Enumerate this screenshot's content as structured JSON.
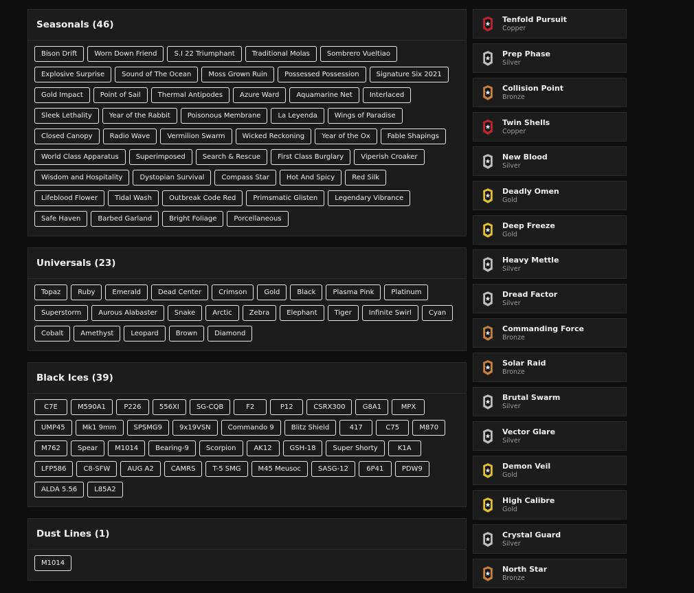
{
  "sections": [
    {
      "title": "Seasonals (46)",
      "tags": [
        "Bison Drift",
        "Worn Down Friend",
        "S.I 22 Triumphant",
        "Traditional Molas",
        "Sombrero Vueltiao",
        "Explosive Surprise",
        "Sound of The Ocean",
        "Moss Grown Ruin",
        "Possessed Possession",
        "Signature Six 2021",
        "Gold Impact",
        "Point of Sail",
        "Thermal Antipodes",
        "Azure Ward",
        "Aquamarine Net",
        "Interlaced",
        "Sleek Lethality",
        "Year of the Rabbit",
        "Poisonous Membrane",
        "La Leyenda",
        "Wings of Paradise",
        "Closed Canopy",
        "Radio Wave",
        "Vermilion Swarm",
        "Wicked Reckoning",
        "Year of the Ox",
        "Fable Shapings",
        "World Class Apparatus",
        "Superimposed",
        "Search & Rescue",
        "First Class Burglary",
        "Viperish Croaker",
        "Wisdom and Hospitality",
        "Dystopian Survival",
        "Compass Star",
        "Hot And Spicy",
        "Red Silk",
        "Lifeblood Flower",
        "Tidal Wash",
        "Outbreak Code Red",
        "Primsmatic Glisten",
        "Legendary Vibrance",
        "Safe Haven",
        "Barbed Garland",
        "Bright Foliage",
        "Porcellaneous"
      ]
    },
    {
      "title": "Universals (23)",
      "tags": [
        "Topaz",
        "Ruby",
        "Emerald",
        "Dead Center",
        "Crimson",
        "Gold",
        "Black",
        "Plasma Pink",
        "Platinum",
        "Superstorm",
        "Aurous Alabaster",
        "Snake",
        "Arctic",
        "Zebra",
        "Elephant",
        "Tiger",
        "Infinite Swirl",
        "Cyan",
        "Cobalt",
        "Amethyst",
        "Leopard",
        "Brown",
        "Diamond"
      ]
    },
    {
      "title": "Black Ices (39)",
      "tags": [
        "C7E",
        "M590A1",
        "P226",
        "556XI",
        "SG-CQB",
        "F2",
        "P12",
        "CSRX300",
        "G8A1",
        "MPX",
        "UMP45",
        "Mk1 9mm",
        "SPSMG9",
        "9x19VSN",
        "Commando 9",
        "Blitz Shield",
        "417",
        "C75",
        "M870",
        "M762",
        "Spear",
        "M1014",
        "Bearing-9",
        "Scorpion",
        "AK12",
        "GSH-18",
        "Super Shorty",
        "K1A",
        "LFP586",
        "C8-SFW",
        "AUG A2",
        "CAMRS",
        "T-5 SMG",
        "M45 Meusoc",
        "SASG-12",
        "6P41",
        "PDW9",
        "ALDA 5.56",
        "L85A2"
      ]
    },
    {
      "title": "Dust Lines (1)",
      "tags": [
        "M1014"
      ]
    }
  ],
  "charms": [
    {
      "name": "Tenfold Pursuit",
      "tier": "Copper"
    },
    {
      "name": "Prep Phase",
      "tier": "Silver"
    },
    {
      "name": "Collision Point",
      "tier": "Bronze"
    },
    {
      "name": "Twin Shells",
      "tier": "Copper"
    },
    {
      "name": "New Blood",
      "tier": "Silver"
    },
    {
      "name": "Deadly Omen",
      "tier": "Gold"
    },
    {
      "name": "Deep Freeze",
      "tier": "Gold"
    },
    {
      "name": "Heavy Mettle",
      "tier": "Silver"
    },
    {
      "name": "Dread Factor",
      "tier": "Silver"
    },
    {
      "name": "Commanding Force",
      "tier": "Bronze"
    },
    {
      "name": "Solar Raid",
      "tier": "Bronze"
    },
    {
      "name": "Brutal Swarm",
      "tier": "Silver"
    },
    {
      "name": "Vector Glare",
      "tier": "Silver"
    },
    {
      "name": "Demon Veil",
      "tier": "Gold"
    },
    {
      "name": "High Calibre",
      "tier": "Gold"
    },
    {
      "name": "Crystal Guard",
      "tier": "Silver"
    },
    {
      "name": "North Star",
      "tier": "Bronze"
    }
  ],
  "tier_colors": {
    "Copper": "#c0212d",
    "Silver": "#bfbfbf",
    "Bronze": "#c9803a",
    "Gold": "#e3c02a"
  }
}
